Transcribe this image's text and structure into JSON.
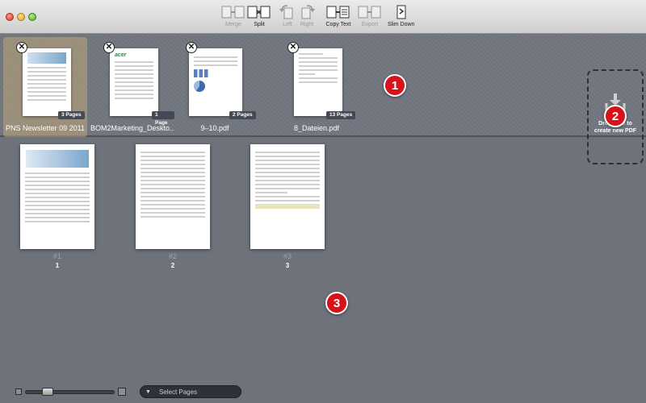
{
  "toolbar": {
    "items": [
      {
        "label": "Merge",
        "enabled": false,
        "icon": "merge-icon"
      },
      {
        "label": "Split",
        "enabled": true,
        "icon": "split-icon"
      },
      {
        "label": "Left",
        "enabled": false,
        "icon": "rotate-left-icon"
      },
      {
        "label": "Right",
        "enabled": false,
        "icon": "rotate-right-icon"
      },
      {
        "label": "Copy Text",
        "enabled": true,
        "icon": "copy-text-icon"
      },
      {
        "label": "Export",
        "enabled": false,
        "icon": "export-icon"
      },
      {
        "label": "Slim Down",
        "enabled": true,
        "icon": "slim-down-icon"
      }
    ]
  },
  "documents": [
    {
      "name": "PNS Newsletter 09 2011",
      "pages": "3 Pages",
      "selected": true
    },
    {
      "name": "BOM2Marketing_Deskto...",
      "pages": "1 Page",
      "selected": false
    },
    {
      "name": "9–10.pdf",
      "pages": "2 Pages",
      "selected": false
    },
    {
      "name": "8_Dateien.pdf",
      "pages": "13 Pages",
      "selected": false
    }
  ],
  "markers": {
    "m1": "1",
    "m2": "2",
    "m3": "3"
  },
  "dropzone": {
    "text_line1": "Drop here to",
    "text_line2": "create new PDF"
  },
  "pages": [
    {
      "number": "#1",
      "label": "1"
    },
    {
      "number": "#2",
      "label": "2"
    },
    {
      "number": "#3",
      "label": "3"
    }
  ],
  "bottom": {
    "select_pages": "Select Pages"
  },
  "colors": {
    "marker": "#d6121a",
    "background": "#6e727b"
  }
}
